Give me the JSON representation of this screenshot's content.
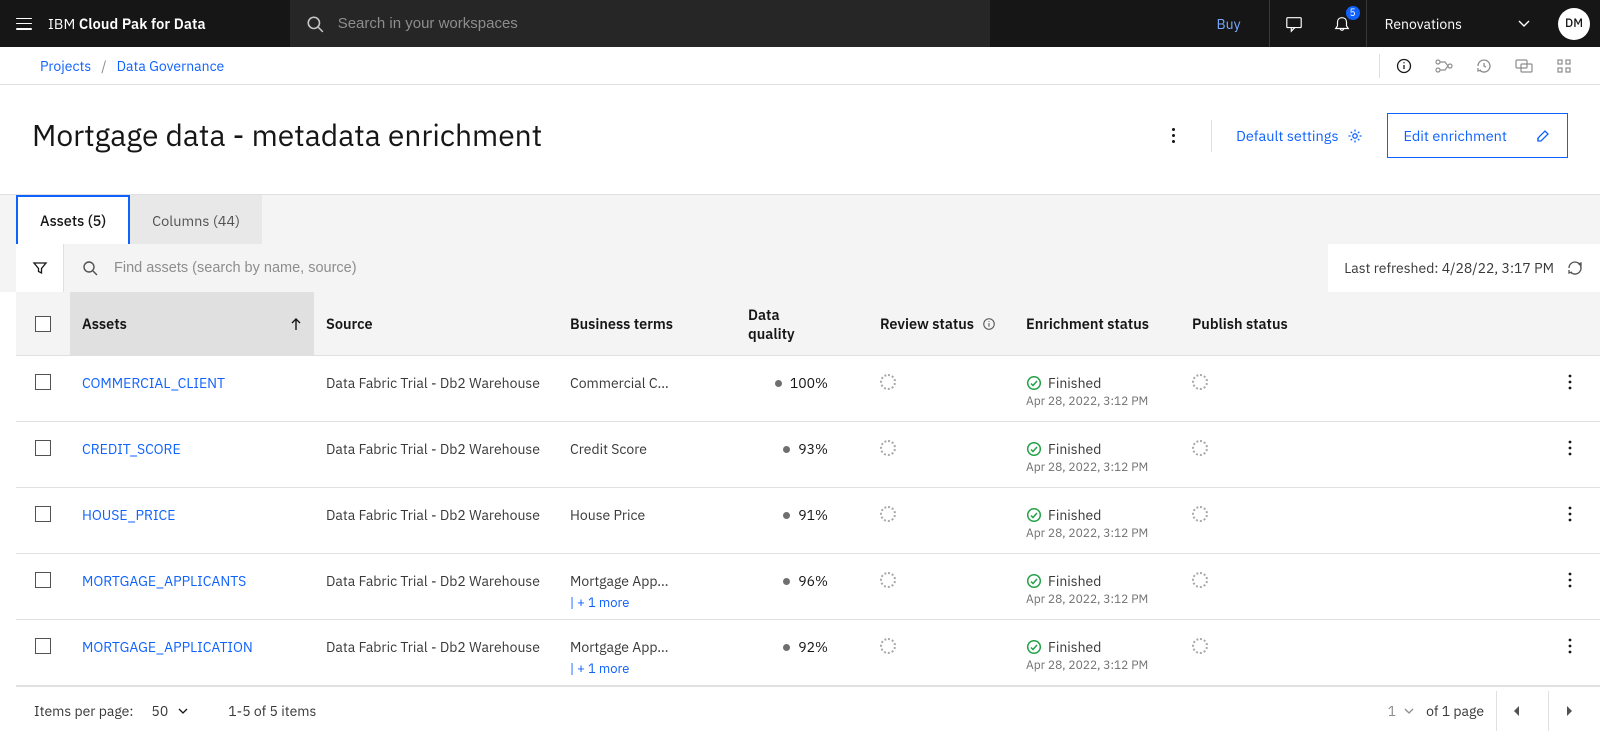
{
  "header": {
    "brand_light": "IBM ",
    "brand_bold": "Cloud Pak for Data",
    "search_placeholder": "Search in your workspaces",
    "buy_label": "Buy",
    "notif_count": "5",
    "org_name": "Renovations",
    "avatar_initials": "DM"
  },
  "breadcrumb": {
    "items": [
      "Projects",
      "Data Governance"
    ]
  },
  "page": {
    "title": "Mortgage data - metadata enrichment",
    "default_settings_label": "Default settings",
    "edit_label": "Edit enrichment"
  },
  "tabs": [
    {
      "label": "Assets (5)",
      "selected": true
    },
    {
      "label": "Columns (44)",
      "selected": false
    }
  ],
  "find": {
    "placeholder": "Find assets (search by name, source)",
    "last_refreshed_label": "Last refreshed: 4/28/22, 3:17 PM"
  },
  "columns": {
    "assets": "Assets",
    "source": "Source",
    "terms": "Business terms",
    "dq": "Data quality",
    "review": "Review status",
    "enrich": "Enrichment status",
    "publish": "Publish status"
  },
  "rows": [
    {
      "asset": "COMMERCIAL_CLIENT",
      "source": "Data Fabric Trial - Db2 Warehouse",
      "terms": "Commercial C…",
      "more": "",
      "dq": "100%",
      "status": "Finished",
      "status_time": "Apr 28, 2022, 3:12 PM"
    },
    {
      "asset": "CREDIT_SCORE",
      "source": "Data Fabric Trial - Db2 Warehouse",
      "terms": "Credit Score",
      "more": "",
      "dq": "93%",
      "status": "Finished",
      "status_time": "Apr 28, 2022, 3:12 PM"
    },
    {
      "asset": "HOUSE_PRICE",
      "source": "Data Fabric Trial - Db2 Warehouse",
      "terms": "House Price",
      "more": "",
      "dq": "91%",
      "status": "Finished",
      "status_time": "Apr 28, 2022, 3:12 PM"
    },
    {
      "asset": "MORTGAGE_APPLICANTS",
      "source": "Data Fabric Trial - Db2 Warehouse",
      "terms": "Mortgage App…",
      "more": "| + 1 more",
      "dq": "96%",
      "status": "Finished",
      "status_time": "Apr 28, 2022, 3:12 PM"
    },
    {
      "asset": "MORTGAGE_APPLICATION",
      "source": "Data Fabric Trial - Db2 Warehouse",
      "terms": "Mortgage App…",
      "more": "| + 1 more",
      "dq": "92%",
      "status": "Finished",
      "status_time": "Apr 28, 2022, 3:12 PM"
    }
  ],
  "pager": {
    "ipp_label": "Items per page:",
    "ipp_value": "50",
    "range": "1-5 of 5 items",
    "page_num": "1",
    "of_pages": "of 1 page"
  }
}
